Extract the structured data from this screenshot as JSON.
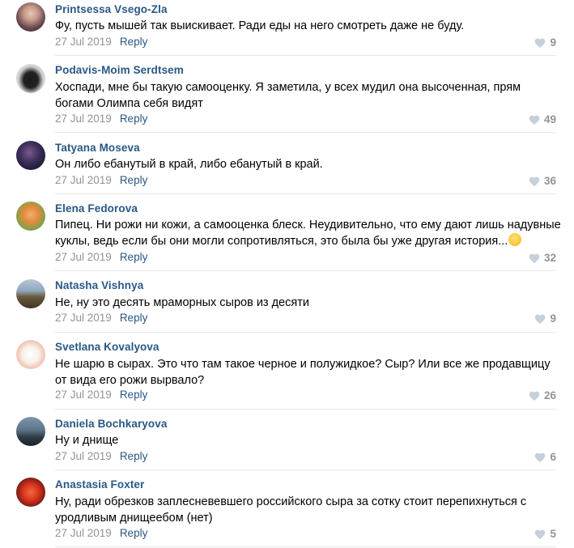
{
  "colors": {
    "author_link": "#2a5885",
    "meta_gray": "#939393",
    "divider": "#e7e8ec"
  },
  "icons": {
    "like": "heart-icon",
    "emoji": "smirk-face-emoji"
  },
  "comments": [
    {
      "author": "Printsessa Vsego-Zla",
      "text": "Фу, пусть мышей так выискивает. Ради еды на него смотреть даже не буду.",
      "date": "27 Jul 2019",
      "reply_label": "Reply",
      "likes": "9"
    },
    {
      "author": "Podavis-Moim Serdtsem",
      "text": "Хоспади, мне бы такую самооценку. Я заметила, у всех мудил она высоченная, прям богами Олимпа себя видят",
      "date": "27 Jul 2019",
      "reply_label": "Reply",
      "likes": "49"
    },
    {
      "author": "Tatyana Moseva",
      "text": "Он либо ебанутый в край, либо ебанутый в край.",
      "date": "27 Jul 2019",
      "reply_label": "Reply",
      "likes": "36"
    },
    {
      "author": "Elena Fedorova",
      "text": "Пипец. Ни рожи ни кожи, а самооценка блеск. Неудивительно, что ему дают лишь надувные куклы, ведь если бы они могли сопротивляться, это была бы уже другая история...",
      "date": "27 Jul 2019",
      "reply_label": "Reply",
      "likes": "32"
    },
    {
      "author": "Natasha Vishnya",
      "text": "Не, ну это десять мраморных сыров из десяти",
      "date": "27 Jul 2019",
      "reply_label": "Reply",
      "likes": "9"
    },
    {
      "author": "Svetlana Kovalyova",
      "text": "Не шарю в сырах. Это что там такое черное и полужидкое? Сыр? Или все же продавщицу от вида его рожи вырвало?",
      "date": "27 Jul 2019",
      "reply_label": "Reply",
      "likes": "26"
    },
    {
      "author": "Daniela Bochkaryova",
      "text": "Ну и днище",
      "date": "27 Jul 2019",
      "reply_label": "Reply",
      "likes": "6"
    },
    {
      "author": "Anastasia Foxter",
      "text": "Ну, ради обрезков заплесневевшего российского сыра за сотку стоит перепихнуться с уродливым днищеебом (нет)",
      "date": "27 Jul 2019",
      "reply_label": "Reply",
      "likes": "5"
    }
  ]
}
